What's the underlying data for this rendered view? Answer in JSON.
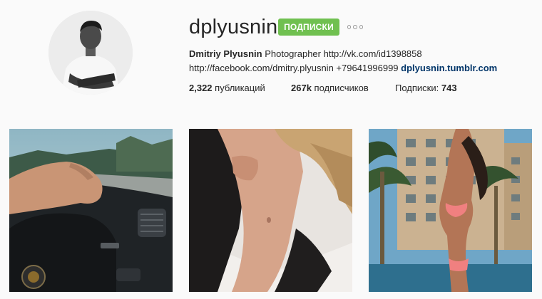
{
  "profile": {
    "username": "dplyusnin",
    "follow_button": "ПОДПИСКИ",
    "more_icon": "more-options-icon",
    "full_name": "Dmitriy Plyusnin",
    "bio_line1_rest": "Photographer http://vk.com/id1398858",
    "bio_line2": "http://facebook.com/dmitry.plyusnin +79641996999",
    "external_link": "dplyusnin.tumblr.com"
  },
  "stats": {
    "posts_count": "2,322",
    "posts_label": "публикаций",
    "followers_count": "267k",
    "followers_label": "подписчиков",
    "following_label": "Подписки:",
    "following_count": "743"
  },
  "colors": {
    "follow_button": "#70c050",
    "link": "#003569",
    "background": "#fafafa"
  },
  "posts": [
    {
      "name": "post-car-interior"
    },
    {
      "name": "post-portrait-bed"
    },
    {
      "name": "post-bikini-palms"
    }
  ]
}
